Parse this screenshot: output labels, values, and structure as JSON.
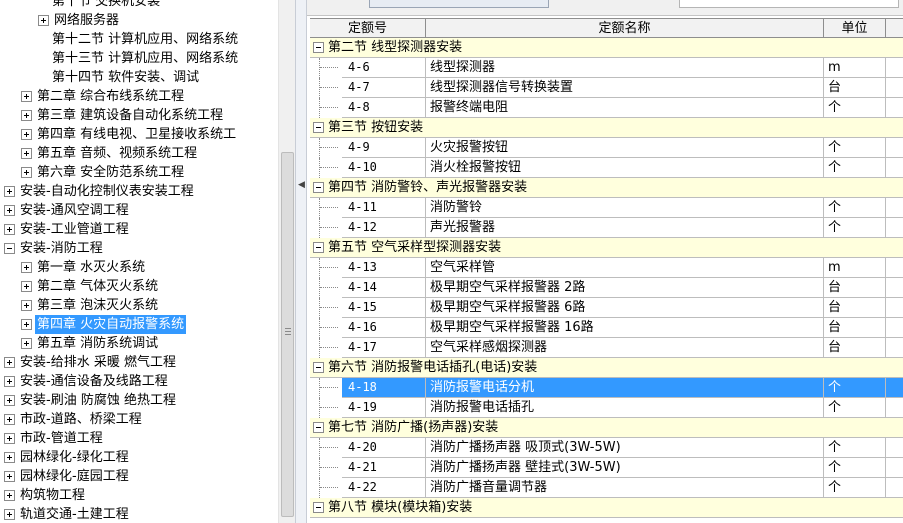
{
  "tree": {
    "rows": [
      {
        "label": "第十节 交换机安装",
        "expander": "none",
        "selected": false
      },
      {
        "label": "网络服务器",
        "expander": "plus",
        "selected": false
      },
      {
        "label": "第十二节 计算机应用、网络系统",
        "expander": "none",
        "selected": false
      },
      {
        "label": "第十三节 计算机应用、网络系统",
        "expander": "none",
        "selected": false
      },
      {
        "label": "第十四节 软件安装、调试",
        "expander": "none",
        "selected": false
      },
      {
        "label": "第二章 综合布线系统工程",
        "expander": "plus",
        "selected": false
      },
      {
        "label": "第三章 建筑设备自动化系统工程",
        "expander": "plus",
        "selected": false
      },
      {
        "label": "第四章 有线电视、卫星接收系统工",
        "expander": "plus",
        "selected": false
      },
      {
        "label": "第五章 音频、视频系统工程",
        "expander": "plus",
        "selected": false
      },
      {
        "label": "第六章 安全防范系统工程",
        "expander": "plus",
        "selected": false
      },
      {
        "label": "安装-自动化控制仪表安装工程",
        "expander": "plus",
        "selected": false
      },
      {
        "label": "安装-通风空调工程",
        "expander": "plus",
        "selected": false
      },
      {
        "label": "安装-工业管道工程",
        "expander": "plus",
        "selected": false
      },
      {
        "label": "安装-消防工程",
        "expander": "minus",
        "selected": false
      },
      {
        "label": "第一章 水灭火系统",
        "expander": "plus",
        "selected": false
      },
      {
        "label": "第二章 气体灭火系统",
        "expander": "plus",
        "selected": false
      },
      {
        "label": "第三章 泡沫灭火系统",
        "expander": "plus",
        "selected": false
      },
      {
        "label": "第四章 火灾自动报警系统",
        "expander": "plus",
        "selected": true
      },
      {
        "label": "第五章 消防系统调试",
        "expander": "plus",
        "selected": false
      },
      {
        "label": "安装-给排水 采暖 燃气工程",
        "expander": "plus",
        "selected": false
      },
      {
        "label": "安装-通信设备及线路工程",
        "expander": "plus",
        "selected": false
      },
      {
        "label": "安装-刷油 防腐蚀 绝热工程",
        "expander": "plus",
        "selected": false
      },
      {
        "label": "市政-道路、桥梁工程",
        "expander": "plus",
        "selected": false
      },
      {
        "label": "市政-管道工程",
        "expander": "plus",
        "selected": false
      },
      {
        "label": "园林绿化-绿化工程",
        "expander": "plus",
        "selected": false
      },
      {
        "label": "园林绿化-庭园工程",
        "expander": "plus",
        "selected": false
      },
      {
        "label": "构筑物工程",
        "expander": "plus",
        "selected": false
      },
      {
        "label": "轨道交通-土建工程",
        "expander": "plus",
        "selected": false
      }
    ]
  },
  "grid": {
    "headers": {
      "code": "定额号",
      "name": "定额名称",
      "unit": "单位"
    },
    "rows": [
      {
        "type": "section",
        "title": "第二节 线型探测器安装"
      },
      {
        "type": "item",
        "code": "4-6",
        "name": "线型探测器",
        "unit": "m"
      },
      {
        "type": "item",
        "code": "4-7",
        "name": "线型探测器信号转换装置",
        "unit": "台"
      },
      {
        "type": "item",
        "code": "4-8",
        "name": "报警终端电阻",
        "unit": "个"
      },
      {
        "type": "section",
        "title": "第三节 按钮安装"
      },
      {
        "type": "item",
        "code": "4-9",
        "name": "火灾报警按钮",
        "unit": "个"
      },
      {
        "type": "item",
        "code": "4-10",
        "name": "消火栓报警按钮",
        "unit": "个"
      },
      {
        "type": "section",
        "title": "第四节 消防警铃、声光报警器安装"
      },
      {
        "type": "item",
        "code": "4-11",
        "name": "消防警铃",
        "unit": "个"
      },
      {
        "type": "item",
        "code": "4-12",
        "name": "声光报警器",
        "unit": "个"
      },
      {
        "type": "section",
        "title": "第五节 空气采样型探测器安装"
      },
      {
        "type": "item",
        "code": "4-13",
        "name": "空气采样管",
        "unit": "m"
      },
      {
        "type": "item",
        "code": "4-14",
        "name": "极早期空气采样报警器 2路",
        "unit": "台"
      },
      {
        "type": "item",
        "code": "4-15",
        "name": "极早期空气采样报警器 6路",
        "unit": "台"
      },
      {
        "type": "item",
        "code": "4-16",
        "name": "极早期空气采样报警器 16路",
        "unit": "台"
      },
      {
        "type": "item",
        "code": "4-17",
        "name": "空气采样感烟探测器",
        "unit": "台"
      },
      {
        "type": "section",
        "title": "第六节 消防报警电话插孔(电话)安装"
      },
      {
        "type": "item",
        "code": "4-18",
        "name": "消防报警电话分机",
        "unit": "个",
        "selected": true
      },
      {
        "type": "item",
        "code": "4-19",
        "name": "消防报警电话插孔",
        "unit": "个"
      },
      {
        "type": "section",
        "title": "第七节 消防广播(扬声器)安装"
      },
      {
        "type": "item",
        "code": "4-20",
        "name": "消防广播扬声器 吸顶式(3W-5W)",
        "unit": "个"
      },
      {
        "type": "item",
        "code": "4-21",
        "name": "消防广播扬声器 壁挂式(3W-5W)",
        "unit": "个"
      },
      {
        "type": "item",
        "code": "4-22",
        "name": "消防广播音量调节器",
        "unit": "个"
      },
      {
        "type": "section",
        "title": "第八节 模块(模块箱)安装"
      }
    ]
  },
  "icons": {
    "expand": "plus-box-icon",
    "collapse": "minus-box-icon",
    "splitter": "chevron-left-icon"
  }
}
